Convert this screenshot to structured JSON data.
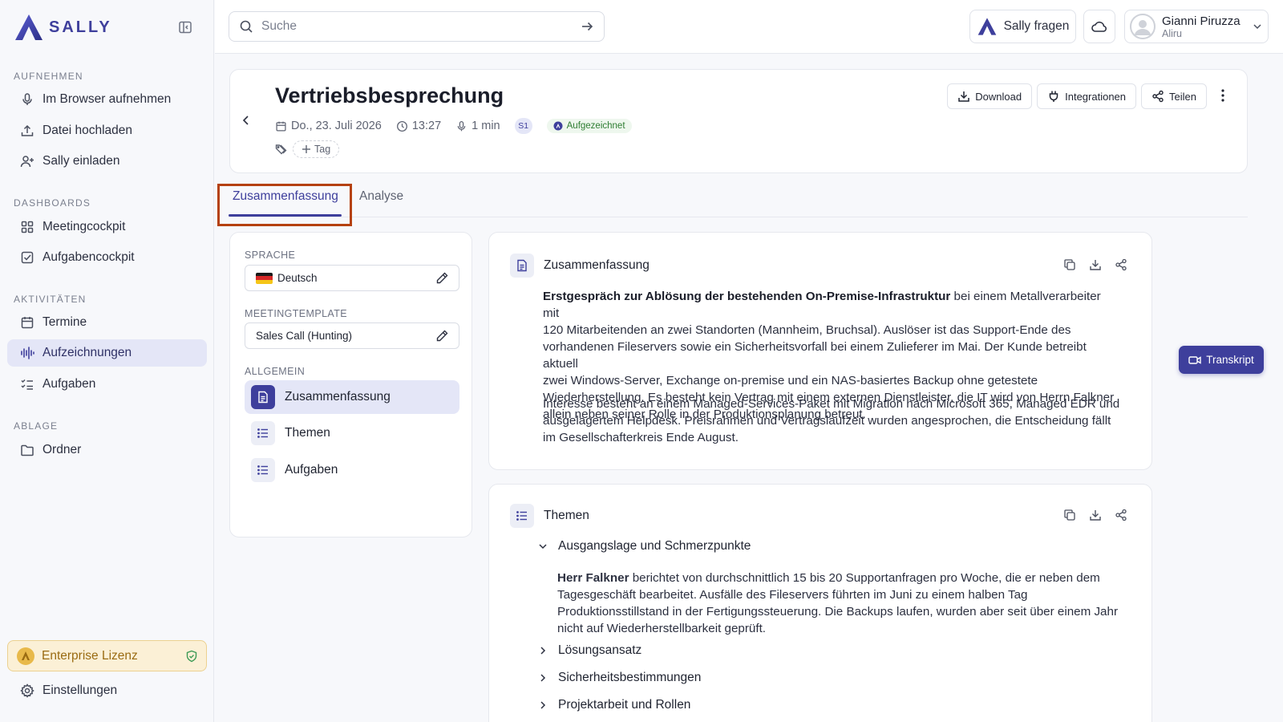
{
  "app": {
    "logo_text": "SALLY",
    "brand_color": "#3e3f9c"
  },
  "sidebar": {
    "sections": [
      {
        "title": "AUFNEHMEN"
      },
      {
        "title": "DASHBOARDS"
      },
      {
        "title": "AKTIVITÄTEN"
      },
      {
        "title": "ABLAGE"
      }
    ],
    "items": [
      {
        "label": "Im Browser aufnehmen",
        "icon": "microphone-icon"
      },
      {
        "label": "Datei hochladen",
        "icon": "upload-icon"
      },
      {
        "label": "Sally einladen",
        "icon": "user-plus-icon"
      },
      {
        "label": "Meetingcockpit",
        "icon": "grid-icon"
      },
      {
        "label": "Aufgabencockpit",
        "icon": "checkbox-icon"
      },
      {
        "label": "Termine",
        "icon": "calendar-icon"
      },
      {
        "label": "Aufzeichnungen",
        "icon": "waveform-icon",
        "active": true
      },
      {
        "label": "Aufgaben",
        "icon": "checklist-icon"
      },
      {
        "label": "Ordner",
        "icon": "folder-icon"
      }
    ],
    "license_label": "Enterprise Lizenz",
    "settings_label": "Einstellungen"
  },
  "topbar": {
    "search_placeholder": "Suche",
    "ask_label": "Sally fragen",
    "user_name": "Gianni Piruzza",
    "user_org": "Aliru"
  },
  "meeting": {
    "title": "Vertriebsbesprechung",
    "date": "Do., 23. Juli 2026",
    "time": "13:27",
    "duration": "1 min",
    "speaker_badge": "S1",
    "status": "Aufgezeichnet",
    "tag_label": "Tag",
    "actions": {
      "download": "Download",
      "integrations": "Integrationen",
      "share": "Teilen"
    }
  },
  "tabs": [
    {
      "label": "Zusammenfassung",
      "active": true
    },
    {
      "label": "Analyse",
      "active": false
    }
  ],
  "panel": {
    "language_label": "SPRACHE",
    "language_value": "Deutsch",
    "template_label": "MEETINGTEMPLATE",
    "template_value": "Sales Call (Hunting)",
    "general_label": "ALLGEMEIN",
    "sections": [
      {
        "label": "Zusammenfassung",
        "active": true
      },
      {
        "label": "Themen",
        "active": false
      },
      {
        "label": "Aufgaben",
        "active": false
      }
    ]
  },
  "summary": {
    "heading": "Zusammenfassung",
    "p1_bold": "Erstgespräch zur Ablösung der bestehenden On-Premise-Infrastruktur",
    "p1_rest_line1": " bei einem Metallverarbeiter mit",
    "p1_lines": [
      "120 Mitarbeitenden an zwei Standorten (Mannheim, Bruchsal). Auslöser ist das Support-Ende des",
      "vorhandenen Fileservers sowie ein Sicherheitsvorfall bei einem Zulieferer im Mai. Der Kunde betreibt aktuell",
      "zwei Windows-Server, Exchange on-premise und ein NAS-basiertes Backup ohne getestete",
      "Wiederherstellung. Es besteht kein Vertrag mit einem externen Dienstleister, die IT wird von Herrn Falkner",
      "allein neben seiner Rolle in der Produktionsplanung betreut."
    ],
    "p2_lines": [
      "Interesse besteht an einem Managed-Services-Paket mit Migration nach Microsoft 365, Managed EDR und",
      "ausgelagertem Helpdesk. Preisrahmen und Vertragslaufzeit wurden angesprochen, die Entscheidung fällt",
      "im Gesellschafterkreis Ende August."
    ]
  },
  "topics": {
    "heading": "Themen",
    "items": [
      {
        "label": "Ausgangslage und Schmerzpunkte",
        "expanded": true
      },
      {
        "label": "Lösungsansatz",
        "expanded": false
      },
      {
        "label": "Sicherheitsbestimmungen",
        "expanded": false
      },
      {
        "label": "Projektarbeit und Rollen",
        "expanded": false
      }
    ],
    "first_body_bold": "Herr Falkner",
    "first_body_rest_line1": " berichtet von durchschnittlich 15 bis 20 Supportanfragen pro Woche, die er neben dem",
    "first_body_lines": [
      "Tagesgeschäft bearbeitet. Ausfälle des Fileservers führten im Juni zu einem halben Tag",
      "Produktionsstillstand in der Fertigungssteuerung. Die Backups laufen, wurden aber seit über einem Jahr",
      "nicht auf Wiederherstellbarkeit geprüft."
    ]
  },
  "transcript_label": "Transkript"
}
